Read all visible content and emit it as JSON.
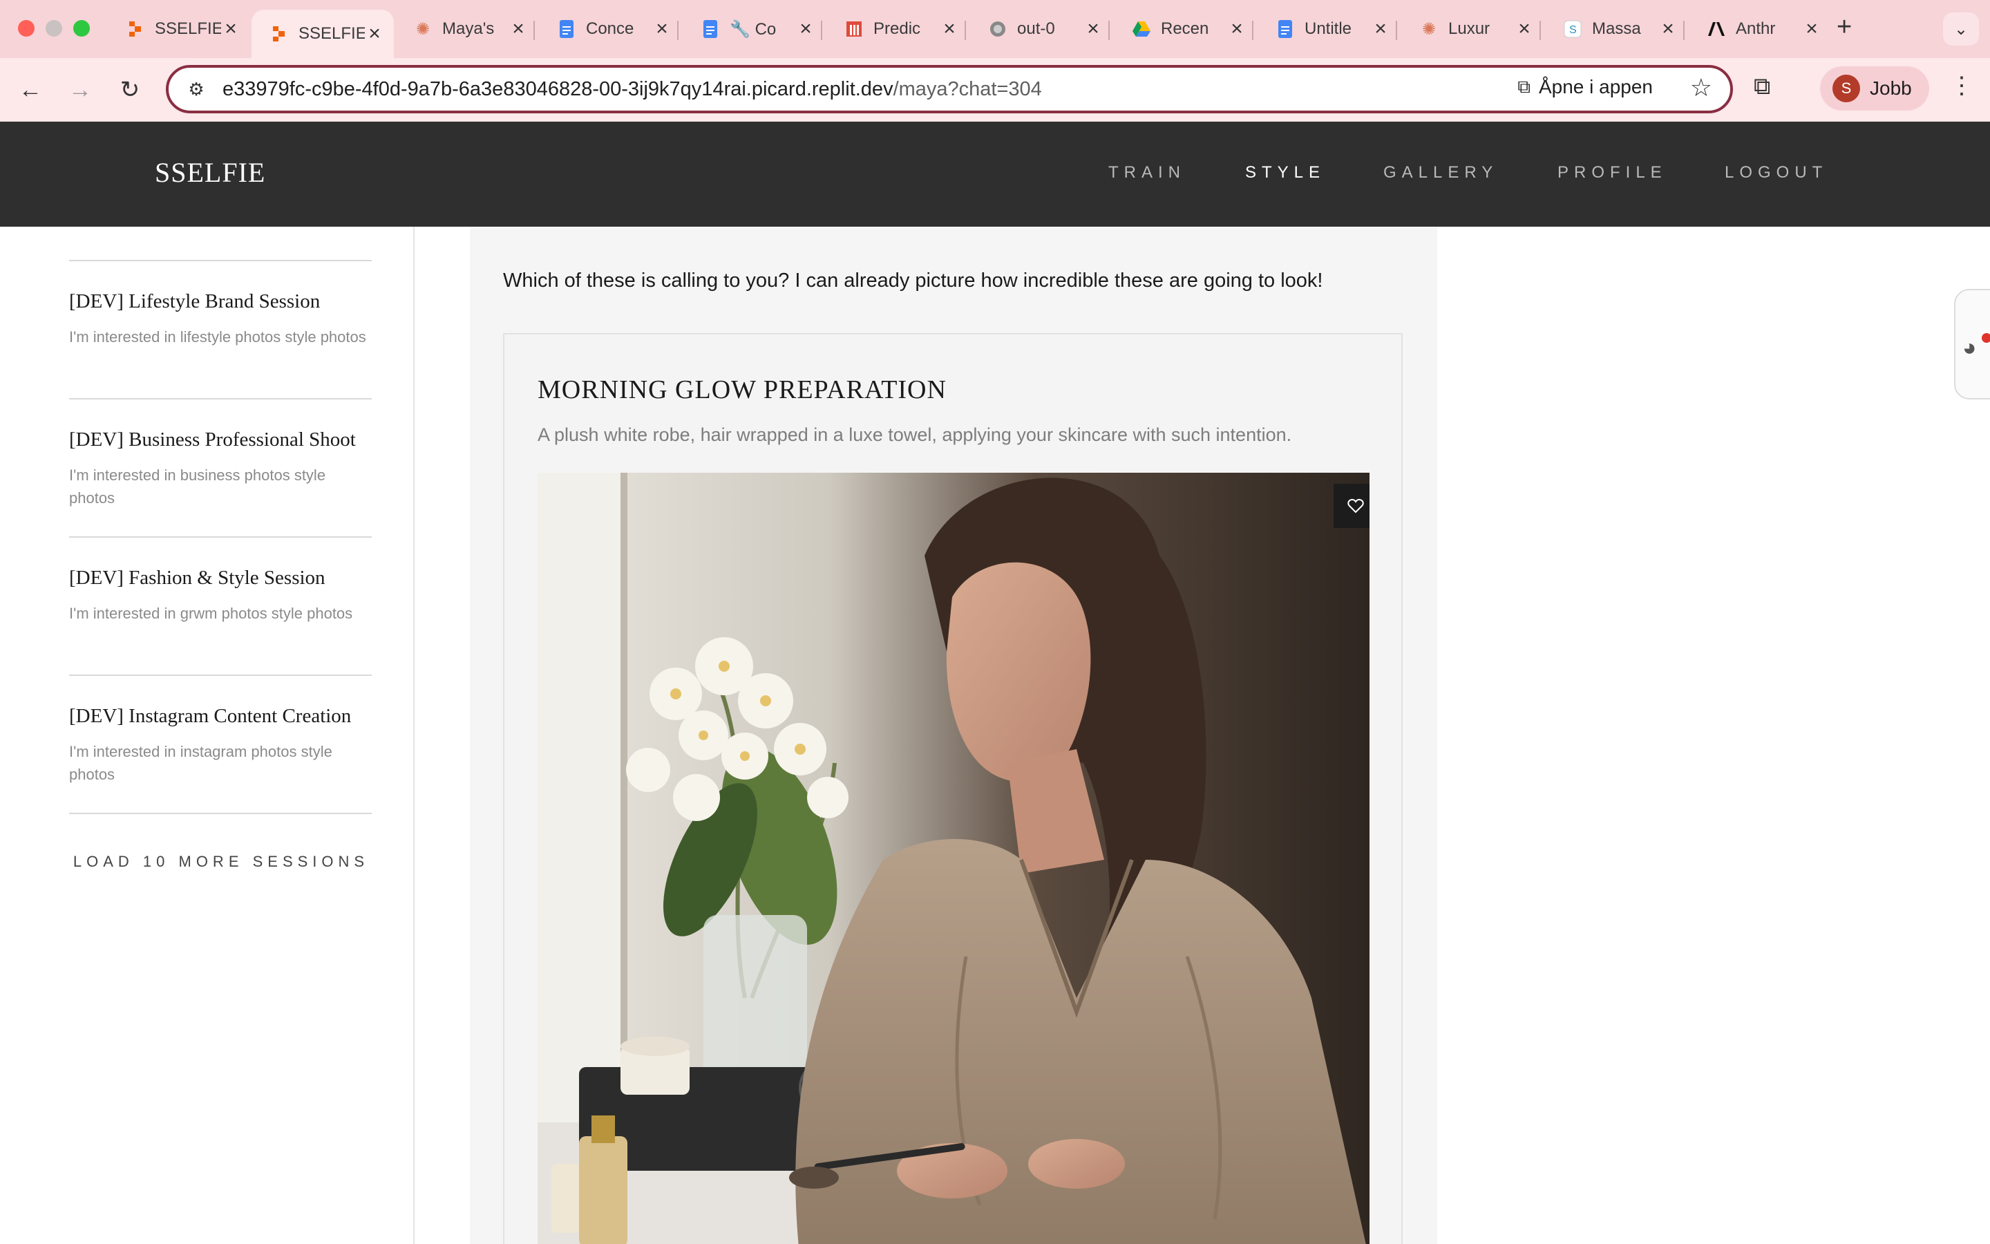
{
  "browser": {
    "tabs": [
      {
        "title": "SSELFIE",
        "icon": "replit-icon",
        "active": false
      },
      {
        "title": "SSELFIE",
        "icon": "replit-icon",
        "active": true
      },
      {
        "title": "Maya's",
        "icon": "claude-icon",
        "active": false
      },
      {
        "title": "Conce",
        "icon": "google-docs-icon",
        "active": false
      },
      {
        "title": "Co",
        "icon": "google-docs-icon",
        "active": false
      },
      {
        "title": "Predic",
        "icon": "tool-icon",
        "active": false
      },
      {
        "title": "out-0",
        "icon": "globe-icon",
        "active": false
      },
      {
        "title": "Recen",
        "icon": "google-drive-icon",
        "active": false
      },
      {
        "title": "Untitle",
        "icon": "google-docs-icon",
        "active": false
      },
      {
        "title": "Luxur",
        "icon": "claude-icon",
        "active": false
      },
      {
        "title": "Massa",
        "icon": "s-icon",
        "active": false
      },
      {
        "title": "Anthr",
        "icon": "anthropic-icon",
        "active": false
      }
    ],
    "url_host": "e33979fc-c9be-4f0d-9a7b-6a3e83046828-00-3ij9k7qy14rai.picard.replit.dev",
    "url_path": "/maya?chat=304",
    "open_in_app": "Åpne i appen",
    "profile_initial": "S",
    "profile_name": "Jobb"
  },
  "app": {
    "brand": "SSELFIE",
    "nav": [
      {
        "label": "TRAIN",
        "active": false
      },
      {
        "label": "STYLE",
        "active": true
      },
      {
        "label": "GALLERY",
        "active": false
      },
      {
        "label": "PROFILE",
        "active": false
      },
      {
        "label": "LOGOUT",
        "active": false
      }
    ]
  },
  "sidebar": {
    "sessions": [
      {
        "title": "[DEV] Lifestyle Brand Session",
        "desc": "I'm interested in lifestyle photos style photos"
      },
      {
        "title": "[DEV] Business Professional Shoot",
        "desc": "I'm interested in business photos style photos"
      },
      {
        "title": "[DEV] Fashion & Style Session",
        "desc": "I'm interested in grwm photos style photos"
      },
      {
        "title": "[DEV] Instagram Content Creation",
        "desc": "I'm interested in instagram photos style photos"
      }
    ],
    "load_more": "LOAD 10 MORE SESSIONS"
  },
  "chat": {
    "message": "Which of these is calling to you? I can already picture how incredible these are going to look!",
    "card": {
      "title": "MORNING GLOW PREPARATION",
      "description": "A plush white robe, hair wrapped in a luxe towel, applying your skincare with such intention."
    }
  },
  "colors": {
    "tabstrip": "#f6d4d8",
    "toolbar": "#fde8ea",
    "app_nav": "#2f2f2f",
    "chat_bg": "#f5f5f5"
  }
}
